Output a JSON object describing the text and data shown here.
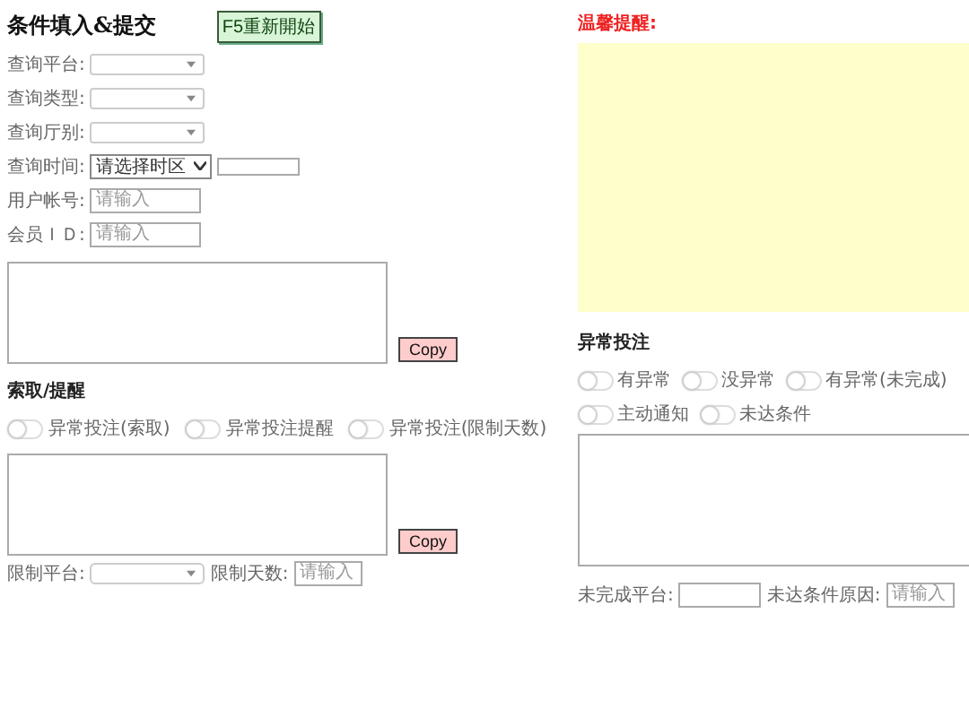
{
  "left": {
    "title": "条件填入&提交",
    "restart_button": "F5重新開始",
    "fields": [
      {
        "kind": "select",
        "label": "查询平台:"
      },
      {
        "kind": "select",
        "label": "查询类型:"
      },
      {
        "kind": "select",
        "label": "查询厅别:"
      },
      {
        "kind": "time",
        "label": "查询时间:",
        "value": "请选择时区"
      },
      {
        "kind": "input",
        "label": "用户帐号:",
        "placeholder": "请输入"
      },
      {
        "kind": "input",
        "label": "会员ＩＤ:",
        "placeholder": "请输入"
      }
    ],
    "copy_button": "Copy",
    "section": "索取/提醒",
    "toggles": [
      {
        "label": "异常投注(索取)",
        "on": false
      },
      {
        "label": "异常投注提醒",
        "on": false
      },
      {
        "label": "异常投注(限制天数)",
        "on": false
      }
    ],
    "copy_button_2": "Copy",
    "bottom": [
      {
        "kind": "select",
        "label": "限制平台:"
      },
      {
        "kind": "input",
        "label": "限制天数:",
        "placeholder": "请输入"
      }
    ]
  },
  "right": {
    "notice_title": "温馨提醒:",
    "section": "异常投注",
    "toggles_row_1": [
      {
        "label": "有异常",
        "on": false
      },
      {
        "label": "没异常",
        "on": false
      },
      {
        "label": "有异常(未完成)",
        "on": false
      }
    ],
    "toggles_row_2": [
      {
        "label": "主动通知",
        "on": false
      },
      {
        "label": "未达条件",
        "on": false
      }
    ],
    "bottom": [
      {
        "kind": "text",
        "label": "未完成平台:"
      },
      {
        "kind": "input",
        "label": "未达条件原因:",
        "placeholder": "请输入"
      }
    ]
  }
}
